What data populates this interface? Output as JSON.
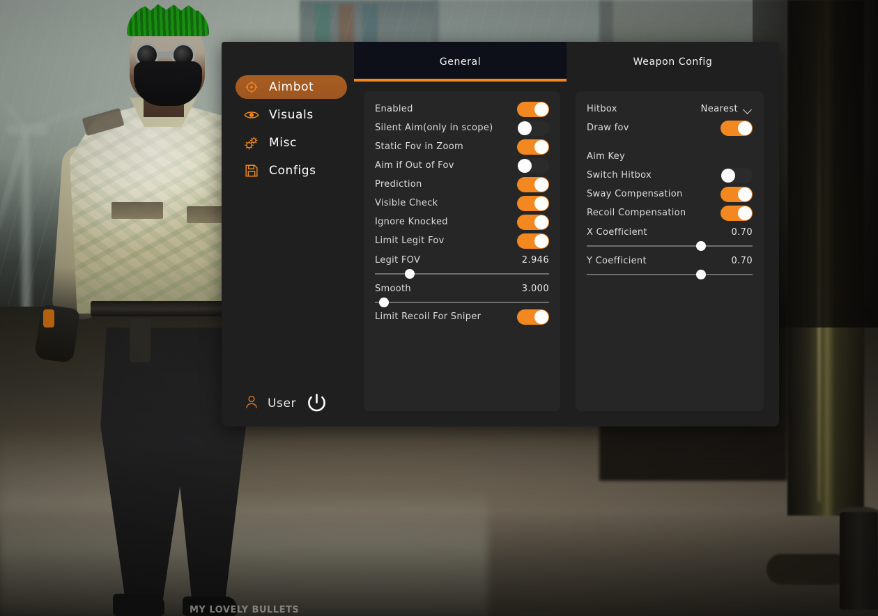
{
  "background": {
    "character_belt_text": "MY LOVELY BULLETS"
  },
  "sidebar": {
    "items": [
      {
        "label": "Aimbot",
        "icon": "crosshair-icon",
        "active": true
      },
      {
        "label": "Visuals",
        "icon": "eye-icon",
        "active": false
      },
      {
        "label": "Misc",
        "icon": "gears-icon",
        "active": false
      },
      {
        "label": "Configs",
        "icon": "floppy-disk-icon",
        "active": false
      }
    ],
    "footer": {
      "user_label": "User",
      "user_icon": "user-icon",
      "power_icon": "power-icon"
    }
  },
  "tabs": [
    {
      "label": "General",
      "active": true
    },
    {
      "label": "Weapon Config",
      "active": false
    }
  ],
  "panel_left": {
    "toggles_top": [
      {
        "label": "Enabled",
        "on": true
      },
      {
        "label": "Silent Aim(only in scope)",
        "on": false
      },
      {
        "label": "Static Fov in Zoom",
        "on": true
      },
      {
        "label": "Aim if Out of Fov",
        "on": false
      },
      {
        "label": "Prediction",
        "on": true
      },
      {
        "label": "Visible Check",
        "on": true
      },
      {
        "label": "Ignore Knocked",
        "on": true
      },
      {
        "label": "Limit Legit Fov",
        "on": true
      }
    ],
    "sliders": [
      {
        "label": "Legit FOV",
        "value": "2.946",
        "percent": 20
      },
      {
        "label": "Smooth",
        "value": "3.000",
        "percent": 5
      }
    ],
    "toggles_bottom": [
      {
        "label": "Limit Recoil For Sniper",
        "on": true
      }
    ]
  },
  "panel_right": {
    "hitbox": {
      "label": "Hitbox",
      "value": "Nearest"
    },
    "draw_fov": {
      "label": "Draw fov",
      "on": true
    },
    "aim_key_label": "Aim Key",
    "toggles": [
      {
        "label": "Switch Hitbox",
        "on": false
      },
      {
        "label": "Sway Compensation",
        "on": true
      },
      {
        "label": "Recoil Compensation",
        "on": true
      }
    ],
    "sliders": [
      {
        "label": "X Coefficient",
        "value": "0.70",
        "percent": 69
      },
      {
        "label": "Y Coefficient",
        "value": "0.70",
        "percent": 69
      }
    ]
  },
  "colors": {
    "accent": "#f2881f",
    "accent_nav": "#a85e22",
    "panel": "#262626",
    "window": "#1f1f1f",
    "tab_active_bg": "#0d1019",
    "text": "#dcdcdc"
  }
}
